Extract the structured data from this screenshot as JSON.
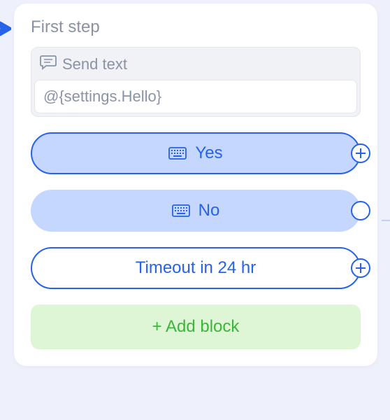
{
  "card": {
    "title": "First step",
    "send_block": {
      "header_label": "Send text",
      "content": "@{settings.Hello}"
    },
    "options": [
      {
        "label": "Yes"
      },
      {
        "label": "No"
      },
      {
        "label": "Timeout in 24 hr"
      }
    ],
    "add_block_label": "+ Add block"
  }
}
